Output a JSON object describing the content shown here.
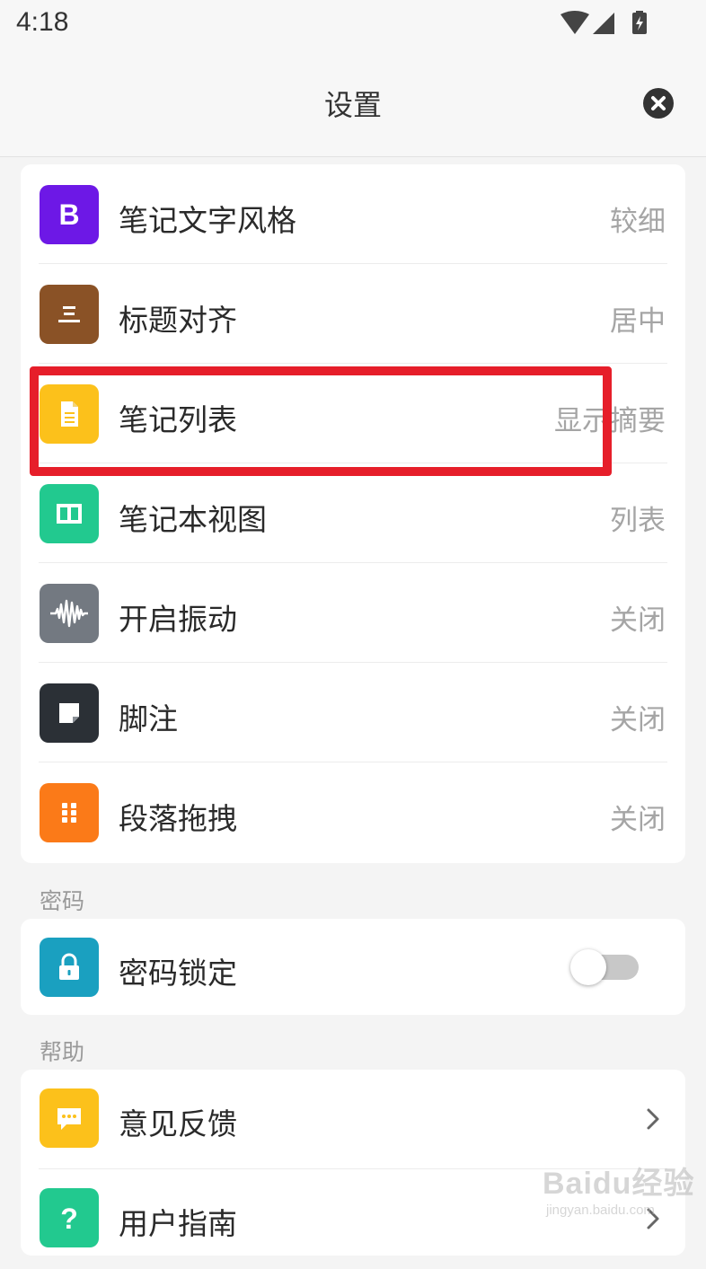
{
  "status_bar": {
    "time": "4:18",
    "icons": [
      "wifi-icon",
      "signal-icon",
      "battery-charging-icon"
    ]
  },
  "header": {
    "title": "设置",
    "close_icon": "close-icon"
  },
  "settings_list": {
    "items": [
      {
        "label": "笔记文字风格",
        "value": "较细",
        "icon": "bold-b-icon",
        "color": "#6d18e6"
      },
      {
        "label": "标题对齐",
        "value": "居中",
        "icon": "align-center-icon",
        "color": "#8a5226"
      },
      {
        "label": "笔记列表",
        "value": "显示摘要",
        "icon": "document-icon",
        "color": "#fcc11b"
      },
      {
        "label": "笔记本视图",
        "value": "列表",
        "icon": "columns-icon",
        "color": "#22c98f"
      },
      {
        "label": "开启振动",
        "value": "关闭",
        "icon": "waveform-icon",
        "color": "#737981"
      },
      {
        "label": "脚注",
        "value": "关闭",
        "icon": "footnote-note-icon",
        "color": "#2b3036"
      },
      {
        "label": "段落拖拽",
        "value": "关闭",
        "icon": "drag-handle-icon",
        "color": "#fb7a18"
      }
    ]
  },
  "password_section": {
    "title": "密码",
    "lock_label": "密码锁定",
    "lock_icon": "lock-icon",
    "lock_color": "#1aa0c0",
    "lock_enabled": false
  },
  "help_section": {
    "title": "帮助",
    "items": [
      {
        "label": "意见反馈",
        "icon": "chat-bubble-icon",
        "color": "#fcc11b"
      },
      {
        "label": "用户指南",
        "icon": "question-icon",
        "color": "#22c98f"
      }
    ]
  },
  "annotation": {
    "color": "#e61e2a"
  },
  "watermark": {
    "main": "Baidu经验",
    "sub": "jingyan.baidu.com"
  }
}
